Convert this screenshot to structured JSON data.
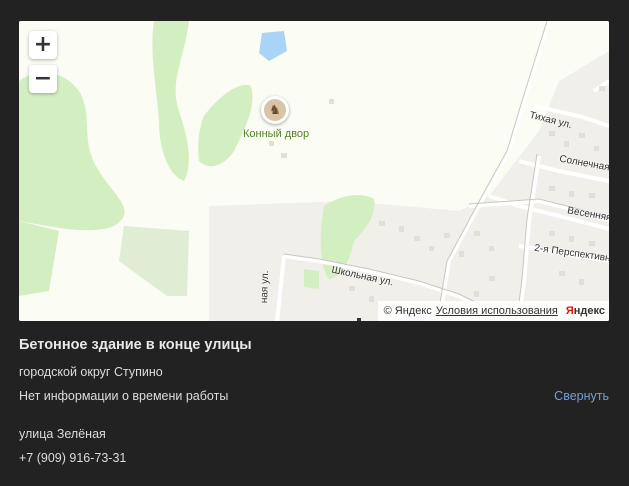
{
  "map": {
    "zoom_in": "+",
    "zoom_out": "−",
    "poi_label": "Конный двор",
    "streets": {
      "tikhaya": "Тихая ул.",
      "solnechnaya": "Солнечная",
      "vesennyaya": "Весенняя",
      "perspektivnaya": "2-я Перспективн",
      "shkolnaya": "Школьная ул.",
      "vertical": "ная ул."
    },
    "copyright": "© Яндекс",
    "terms": "Условия использования",
    "brand_first": "Я",
    "brand_rest": "ндекс"
  },
  "info": {
    "title": "Бетонное здание в конце улицы",
    "district": "городской округ Ступино",
    "hours": "Нет информации о времени работы",
    "collapse": "Свернуть",
    "address": "улица Зелёная",
    "phone": "+7 (909) 916-73-31"
  }
}
